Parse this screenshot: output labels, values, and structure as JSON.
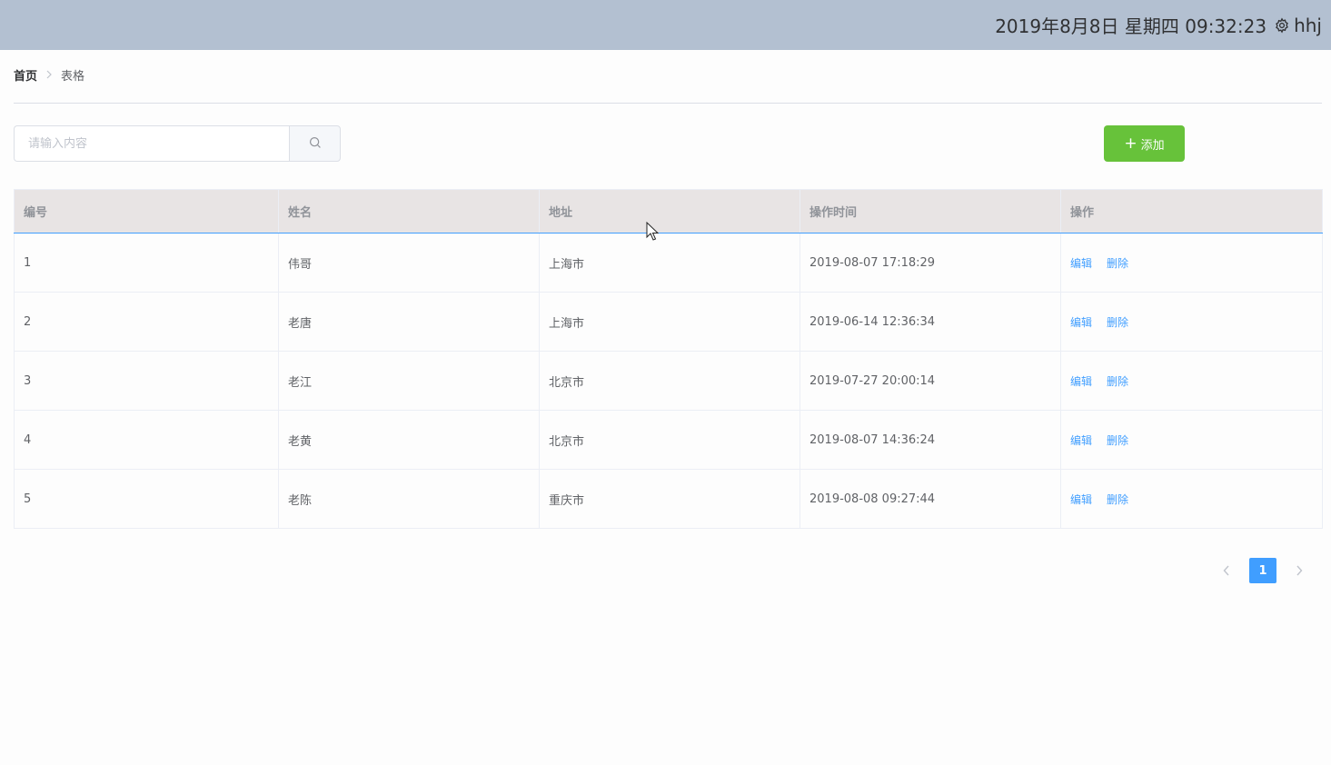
{
  "header": {
    "datetime": "2019年8月8日 星期四 09:32:23",
    "username": "hhj"
  },
  "breadcrumb": {
    "home": "首页",
    "current": "表格"
  },
  "search": {
    "placeholder": "请输入内容",
    "value": ""
  },
  "toolbar": {
    "add_label": "添加"
  },
  "table": {
    "columns": [
      "编号",
      "姓名",
      "地址",
      "操作时间",
      "操作"
    ],
    "rows": [
      {
        "id": "1",
        "name": "伟哥",
        "address": "上海市",
        "time": "2019-08-07 17:18:29"
      },
      {
        "id": "2",
        "name": "老唐",
        "address": "上海市",
        "time": "2019-06-14 12:36:34"
      },
      {
        "id": "3",
        "name": "老江",
        "address": "北京市",
        "time": "2019-07-27 20:00:14"
      },
      {
        "id": "4",
        "name": "老黄",
        "address": "北京市",
        "time": "2019-08-07 14:36:24"
      },
      {
        "id": "5",
        "name": "老陈",
        "address": "重庆市",
        "time": "2019-08-08 09:27:44"
      }
    ],
    "edit_label": "编辑",
    "delete_label": "删除"
  },
  "pagination": {
    "current_page": "1"
  },
  "colors": {
    "header_bg": "#b3c0d1",
    "primary": "#409eff",
    "success": "#67c23a"
  }
}
